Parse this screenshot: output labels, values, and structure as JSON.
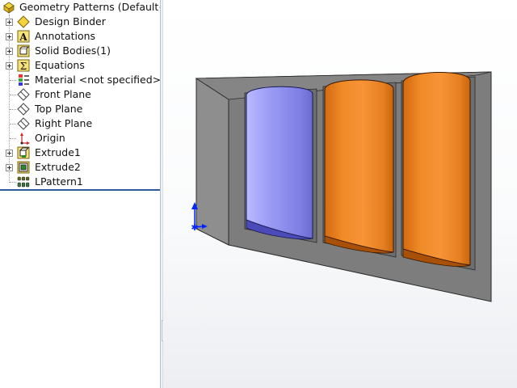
{
  "feature_tree": {
    "root_label": "Geometry Patterns  (Default<<",
    "items": [
      {
        "label": "Design Binder",
        "icon": "design-binder-icon",
        "expandable": true
      },
      {
        "label": "Annotations",
        "icon": "annotations-icon",
        "expandable": true
      },
      {
        "label": "Solid Bodies(1)",
        "icon": "solid-bodies-icon",
        "expandable": true
      },
      {
        "label": "Equations",
        "icon": "equations-icon",
        "expandable": true
      },
      {
        "label": "Material <not specified>",
        "icon": "material-icon",
        "expandable": false
      },
      {
        "label": "Front Plane",
        "icon": "plane-icon",
        "expandable": false
      },
      {
        "label": "Top Plane",
        "icon": "plane-icon",
        "expandable": false
      },
      {
        "label": "Right Plane",
        "icon": "plane-icon",
        "expandable": false
      },
      {
        "label": "Origin",
        "icon": "origin-icon",
        "expandable": false
      },
      {
        "label": "Extrude1",
        "icon": "extrude-icon",
        "expandable": true
      },
      {
        "label": "Extrude2",
        "icon": "extrude-icon",
        "expandable": true
      },
      {
        "label": "LPattern1",
        "icon": "linear-pattern-icon",
        "expandable": false
      }
    ]
  },
  "colors": {
    "block_face": "#7e7e7e",
    "block_side": "#8c8c8c",
    "selected_body": "#8f8ff2",
    "pattern_body": "#f08a28",
    "rollback_bar": "#2b5b9c",
    "axis": "#0026ff"
  }
}
